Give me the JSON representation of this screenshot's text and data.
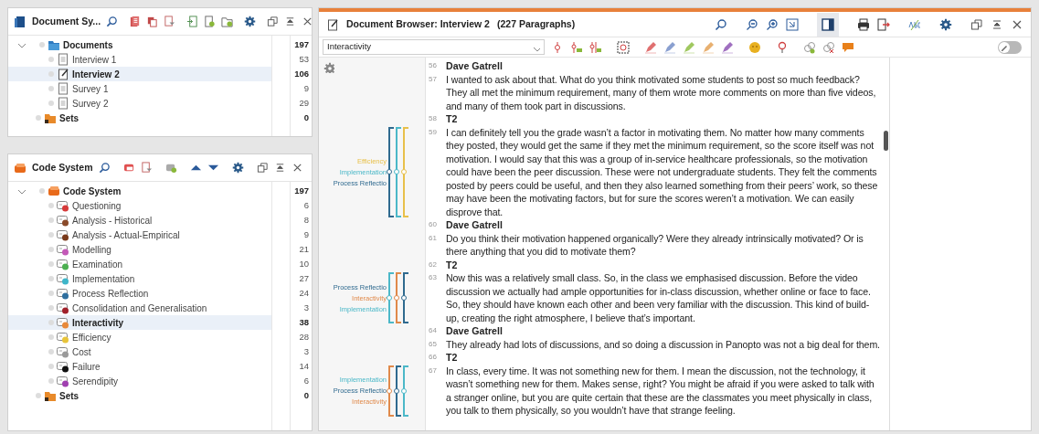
{
  "document_system": {
    "title": "Document Sy...",
    "items": [
      {
        "kind": "folder",
        "label": "Documents",
        "count": "197",
        "selected": false,
        "children": [
          {
            "kind": "document",
            "label": "Interview 1",
            "count": "53",
            "selected": false
          },
          {
            "kind": "document-edit",
            "label": "Interview 2",
            "count": "106",
            "selected": true
          },
          {
            "kind": "document",
            "label": "Survey 1",
            "count": "9",
            "selected": false
          },
          {
            "kind": "document",
            "label": "Survey 2",
            "count": "29",
            "selected": false
          }
        ]
      },
      {
        "kind": "sets",
        "label": "Sets",
        "count": "0",
        "selected": false
      }
    ]
  },
  "code_system": {
    "title": "Code System",
    "items": [
      {
        "kind": "code-root",
        "label": "Code System",
        "count": "197",
        "selected": false,
        "children": [
          {
            "kind": "code",
            "label": "Questioning",
            "count": "6",
            "color": "#d63a3a",
            "selected": false
          },
          {
            "kind": "code",
            "label": "Analysis - Historical",
            "count": "8",
            "color": "#8a4a2a",
            "selected": false
          },
          {
            "kind": "code",
            "label": "Analysis - Actual-Empirical",
            "count": "9",
            "color": "#7a3a1a",
            "selected": false
          },
          {
            "kind": "code",
            "label": "Modelling",
            "count": "21",
            "color": "#c45ab8",
            "selected": false
          },
          {
            "kind": "code",
            "label": "Examination",
            "count": "10",
            "color": "#4caf50",
            "selected": false
          },
          {
            "kind": "code",
            "label": "Implementation",
            "count": "27",
            "color": "#3fb6c9",
            "selected": false
          },
          {
            "kind": "code",
            "label": "Process Reflection",
            "count": "24",
            "color": "#2f6f9f",
            "selected": false
          },
          {
            "kind": "code",
            "label": "Consolidation and Generalisation",
            "count": "3",
            "color": "#a0202a",
            "selected": false
          },
          {
            "kind": "code",
            "label": "Interactivity",
            "count": "38",
            "color": "#e8893a",
            "selected": true
          },
          {
            "kind": "code",
            "label": "Efficiency",
            "count": "28",
            "color": "#e8c43a",
            "selected": false
          },
          {
            "kind": "code",
            "label": "Cost",
            "count": "3",
            "color": "#9a9a9a",
            "selected": false
          },
          {
            "kind": "code",
            "label": "Failure",
            "count": "14",
            "color": "#111111",
            "selected": false
          },
          {
            "kind": "code",
            "label": "Serendipity",
            "count": "6",
            "color": "#a040b0",
            "selected": false
          }
        ]
      },
      {
        "kind": "sets",
        "label": "Sets",
        "count": "0",
        "selected": false
      }
    ]
  },
  "document_browser": {
    "title": "Document Browser: Interview 2",
    "paragraph_count": "(227 Paragraphs)",
    "code_dropdown": {
      "value": "Interactivity"
    },
    "edit_mode_on": false,
    "paragraphs": [
      {
        "number": "56",
        "kind": "speaker",
        "text": "Dave Gatrell"
      },
      {
        "number": "57",
        "kind": "text",
        "text": "I wanted to ask about that. What do you think motivated some students to post so much feedback? They all met the minimum requirement, many of them wrote more comments on more than five videos, and many of them took part in discussions."
      },
      {
        "number": "58",
        "kind": "speaker",
        "text": "T2"
      },
      {
        "number": "59",
        "kind": "text",
        "text": "I can definitely tell you the grade wasn’t a factor in motivating them. No matter how many comments they posted, they would get the same if they met the minimum requirement, so the score itself was not motivation. I would say that this was a group of in-service healthcare professionals, so the motivation could have been the peer discussion. These were not undergraduate students. They felt the comments posted by peers could be useful, and then they also learned something from their peers’ work, so these may have been the motivating factors, but for sure the scores weren’t a motivation. We can easily disprove that.",
        "stripes": [
          {
            "label": "Efficiency",
            "color": "#e8c04a"
          },
          {
            "label": "Implementation",
            "color": "#4bb8c8"
          },
          {
            "label": "Process Reflectio",
            "color": "#2f6a8f"
          }
        ]
      },
      {
        "number": "60",
        "kind": "speaker",
        "text": "Dave Gatrell"
      },
      {
        "number": "61",
        "kind": "text",
        "text": "Do you think their motivation happened organically? Were they already intrinsically motivated? Or is there anything that you did to motivate them?"
      },
      {
        "number": "62",
        "kind": "speaker",
        "text": "T2"
      },
      {
        "number": "63",
        "kind": "text",
        "text": "Now this was a relatively small class. So, in the class we emphasised discussion. Before the video discussion we actually had ample opportunities for in-class discussion, whether online or face to face. So, they should have known each other and been very familiar with the discussion. This kind of build-up, creating the right atmosphere, I believe that’s important.",
        "stripes": [
          {
            "label": "Process Reflectio",
            "color": "#2f6a8f"
          },
          {
            "label": "Interactivity",
            "color": "#e0894a"
          },
          {
            "label": "Implementation",
            "color": "#4bb8c8"
          }
        ]
      },
      {
        "number": "64",
        "kind": "speaker",
        "text": "Dave Gatrell"
      },
      {
        "number": "65",
        "kind": "text",
        "text": "They already had lots of discussions, and so doing a discussion in Panopto was not a big deal for them."
      },
      {
        "number": "66",
        "kind": "speaker",
        "text": "T2"
      },
      {
        "number": "67",
        "kind": "text",
        "text": "In class, every time. It was not something new for them. I mean the discussion, not the technology, it wasn’t something new for them. Makes sense, right? You might be afraid if you were asked to talk with a stranger online, but you are quite certain that these are the classmates you meet physically in class, you talk to them physically, so you wouldn’t have that strange feeling.",
        "stripes": [
          {
            "label": "Implementation",
            "color": "#4bb8c8"
          },
          {
            "label": "Process Reflectio",
            "color": "#2f6a8f"
          },
          {
            "label": "Interactivity",
            "color": "#e0894a"
          }
        ]
      }
    ]
  }
}
